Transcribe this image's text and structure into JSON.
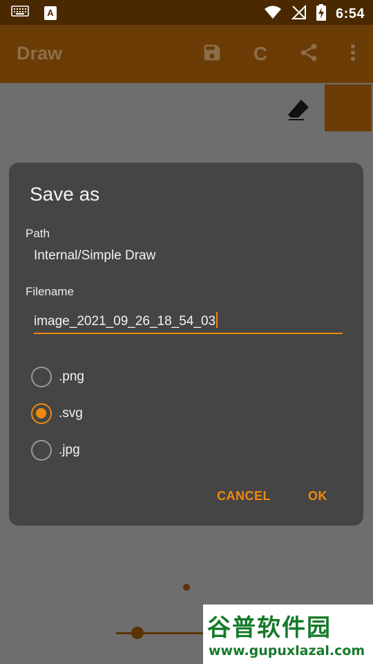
{
  "status_bar": {
    "time": "6:54",
    "notification_a_label": "A",
    "icons": [
      "keyboard-icon",
      "a-notification-icon",
      "wifi-icon",
      "signal-off-icon",
      "battery-charging-icon"
    ]
  },
  "app_bar": {
    "title": "Draw",
    "actions": {
      "save_icon": "save-icon",
      "clear_label": "C",
      "share_icon": "share-icon",
      "more_icon": "more-vert-icon"
    }
  },
  "toolbar": {
    "eraser_icon": "eraser-icon",
    "selected_color": "#6b3c06"
  },
  "dialog": {
    "title": "Save as",
    "path_label": "Path",
    "path_value": "Internal/Simple Draw",
    "filename_label": "Filename",
    "filename_value": "image_2021_09_26_18_54_03",
    "formats": [
      {
        "label": ".png",
        "checked": false
      },
      {
        "label": ".svg",
        "checked": true
      },
      {
        "label": ".jpg",
        "checked": false
      }
    ],
    "cancel_label": "CANCEL",
    "ok_label": "OK"
  },
  "watermark": {
    "chinese_text": "谷普软件园",
    "url": "www.gupuxlazal.com"
  },
  "colors": {
    "accent": "#ef8a0f",
    "primary": "#6b3c06",
    "dialog_bg": "#454545"
  }
}
